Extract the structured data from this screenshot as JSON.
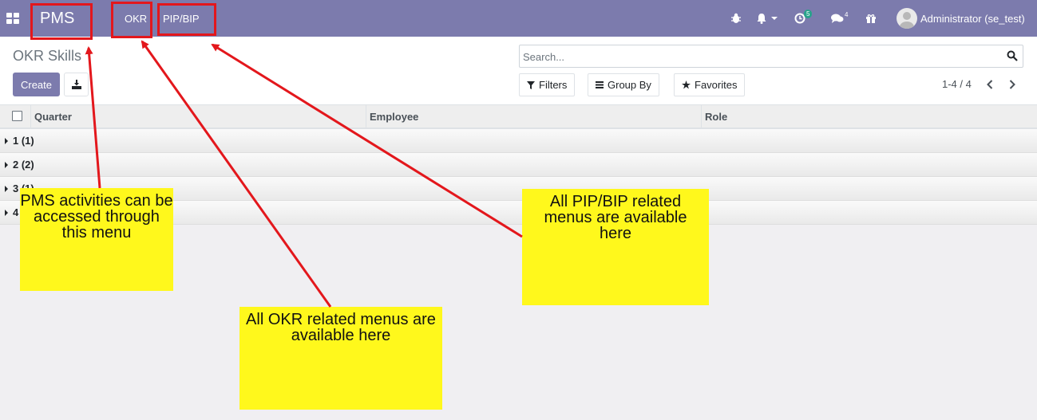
{
  "navbar": {
    "brand": "PMS",
    "menus": [
      {
        "label": "OKR"
      },
      {
        "label": "PIP/BIP"
      }
    ],
    "activity_count": "5",
    "message_count": "4",
    "user_name": "Administrator (se_test)"
  },
  "control_panel": {
    "breadcrumb": "OKR Skills",
    "create_label": "Create",
    "search_placeholder": "Search...",
    "filters_label": "Filters",
    "group_by_label": "Group By",
    "favorites_label": "Favorites",
    "pager": "1-4 / 4"
  },
  "list": {
    "columns": [
      "Quarter",
      "Employee",
      "Role"
    ],
    "groups": [
      {
        "label": "1 (1)"
      },
      {
        "label": "2 (2)"
      },
      {
        "label": "3 (1)"
      },
      {
        "label": "4 (2)"
      }
    ]
  },
  "annotations": {
    "pms_note": "PMS activities can be accessed through this menu",
    "okr_note": "All OKR related menus are available here",
    "pip_note": "All PIP/BIP related menus are available here"
  },
  "colors": {
    "navbar": "#7c7bad",
    "highlight": "#e3171c",
    "note": "#fff81c",
    "badge": "#28a38b"
  }
}
